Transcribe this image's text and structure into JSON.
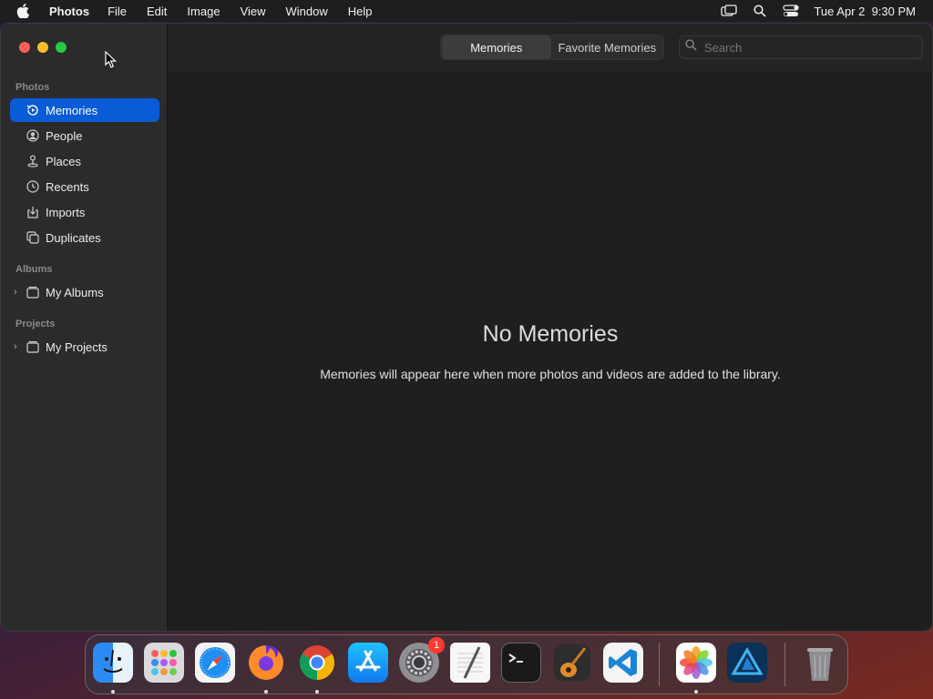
{
  "menubar": {
    "app_name": "Photos",
    "items": [
      "File",
      "Edit",
      "Image",
      "View",
      "Window",
      "Help"
    ],
    "datetime": "Tue Apr 2  9:30 PM"
  },
  "sidebar": {
    "sections": {
      "photos": "Photos",
      "albums": "Albums",
      "projects": "Projects"
    },
    "photos_items": [
      {
        "label": "Memories",
        "icon": "memories-icon"
      },
      {
        "label": "People",
        "icon": "people-icon"
      },
      {
        "label": "Places",
        "icon": "places-icon"
      },
      {
        "label": "Recents",
        "icon": "recents-icon"
      },
      {
        "label": "Imports",
        "icon": "imports-icon"
      },
      {
        "label": "Duplicates",
        "icon": "duplicates-icon"
      }
    ],
    "albums_item": "My Albums",
    "projects_item": "My Projects"
  },
  "toolbar": {
    "tabs": [
      "Memories",
      "Favorite Memories"
    ],
    "search_placeholder": "Search"
  },
  "main": {
    "empty_title": "No Memories",
    "empty_message": "Memories will appear here when more photos and videos are added to the library."
  },
  "dock": {
    "apps": [
      "Finder",
      "Launchpad",
      "Safari",
      "Firefox",
      "Chrome",
      "App Store",
      "System Settings",
      "TextEdit",
      "Terminal",
      "GarageBand",
      "Visual Studio Code",
      "Photos",
      "Affinity Designer",
      "Trash"
    ],
    "settings_badge": "1"
  },
  "colors": {
    "accent": "#0a5bd6",
    "window_bg": "#1f1f1f",
    "sidebar_bg": "#2b2b2b"
  }
}
